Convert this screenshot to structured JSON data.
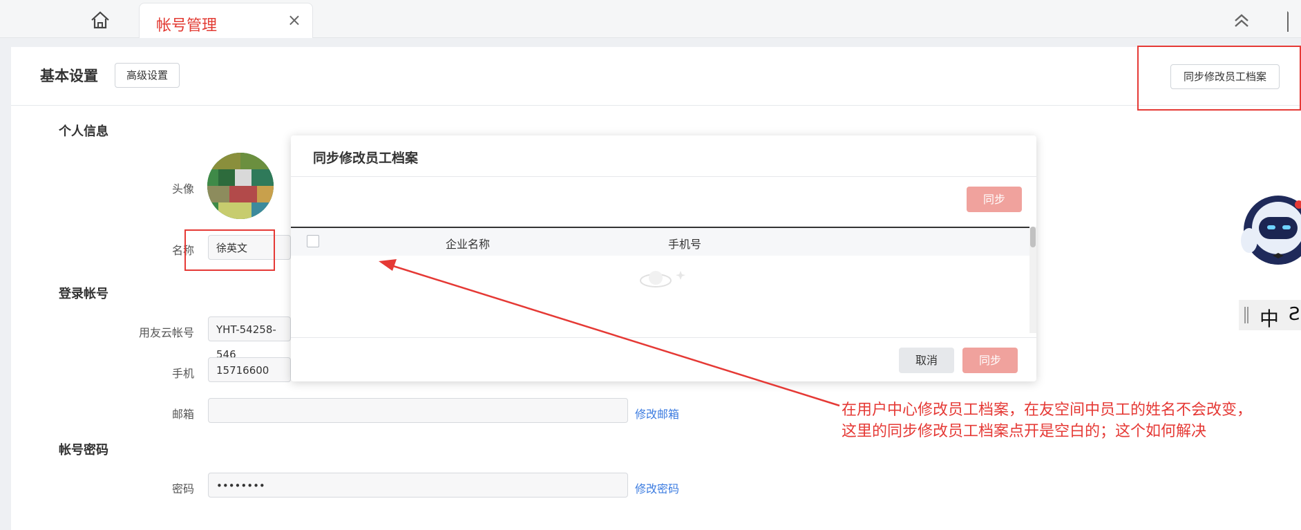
{
  "topbar": {
    "home_icon": "home-icon",
    "tab": {
      "label": "帐号管理",
      "close": "×"
    },
    "collapse_icon": "double-chevron-up-icon",
    "fullscreen_icon": "fullscreen-icon"
  },
  "page": {
    "title": "基本设置",
    "advanced_button": "高级设置",
    "sync_archive_button": "同步修改员工档案"
  },
  "personal": {
    "section": "个人信息",
    "avatar_label": "头像",
    "name_label": "名称",
    "name_value": "徐英文"
  },
  "login": {
    "section": "登录帐号",
    "account_label": "用友云帐号",
    "account_value": "YHT-54258-546",
    "phone_label": "手机",
    "phone_value": "15716600",
    "email_label": "邮箱",
    "email_value": "",
    "email_link": "修改邮箱"
  },
  "password": {
    "section": "帐号密码",
    "label": "密码",
    "value": "••••••••",
    "link": "修改密码"
  },
  "modal": {
    "title": "同步修改员工档案",
    "sync_top": "同步",
    "columns": [
      "企业名称",
      "手机号"
    ],
    "cancel": "取消",
    "sync_bottom": "同步"
  },
  "annotation": {
    "line1": "在用户中心修改员工档案，在友空间中员工的姓名不会改变，",
    "line2": "这里的同步修改员工档案点开是空白的；这个如何解决"
  },
  "side_widget": {
    "robot_icon": "robot-assistant-icon",
    "lang_label": "中",
    "lang_extra": "Ƨ"
  },
  "colors": {
    "accent_red": "#e53935",
    "tab_red": "#e23b33",
    "link_blue": "#3b7be0",
    "sync_button": "#f0a29d"
  }
}
